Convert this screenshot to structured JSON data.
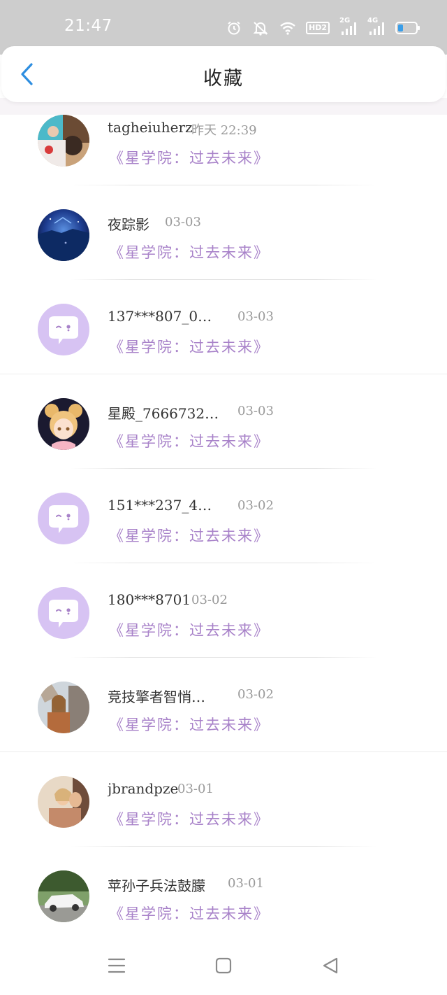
{
  "status_bar": {
    "time": "21:47",
    "hd_label": "HD2",
    "signal_2g": "2G",
    "signal_4g": "4G",
    "icons": [
      "alarm-icon",
      "mute-icon",
      "wifi-icon",
      "hd-icon",
      "signal-2g-icon",
      "signal-4g-icon",
      "battery-icon"
    ]
  },
  "header": {
    "title": "收藏",
    "back_icon": "chevron-left-icon"
  },
  "colors": {
    "accent": "#2e8ee0",
    "book_title": "#a882c9",
    "default_avatar_bg": "#d7c3f3",
    "status_bar_bg": "#cdcdcd"
  },
  "items": [
    {
      "name": "tagheiuherz",
      "time": "昨天 22:39",
      "book": "《星学院：过去未来》",
      "avatar": "photo-avatar"
    },
    {
      "name": "夜踪影",
      "time": "03-03",
      "book": "《星学院：过去未来》",
      "avatar": "night-sky-avatar"
    },
    {
      "name": "137***807_059…",
      "time": "03-03",
      "book": "《星学院：过去未来》",
      "avatar": "default-chat-avatar"
    },
    {
      "name": "星殿_76667328…",
      "time": "03-03",
      "book": "《星学院：过去未来》",
      "avatar": "anime-girl-avatar"
    },
    {
      "name": "151***237_488…",
      "time": "03-02",
      "book": "《星学院：过去未来》",
      "avatar": "default-chat-avatar"
    },
    {
      "name": "180***8701",
      "time": "03-02",
      "book": "《星学院：过去未来》",
      "avatar": "default-chat-avatar"
    },
    {
      "name": "竞技擎者智悄…",
      "time": "03-02",
      "book": "《星学院：过去未来》",
      "avatar": "woman-photo-avatar"
    },
    {
      "name": "jbrandpze",
      "time": "03-01",
      "book": "《星学院：过去未来》",
      "avatar": "couple-photo-avatar"
    },
    {
      "name": "苹孙子兵法鼓朦",
      "time": "03-01",
      "book": "《星学院：过去未来》",
      "avatar": "car-photo-avatar"
    }
  ],
  "nav_bar": {
    "buttons": [
      "menu-icon",
      "home-square-icon",
      "back-triangle-icon"
    ]
  }
}
